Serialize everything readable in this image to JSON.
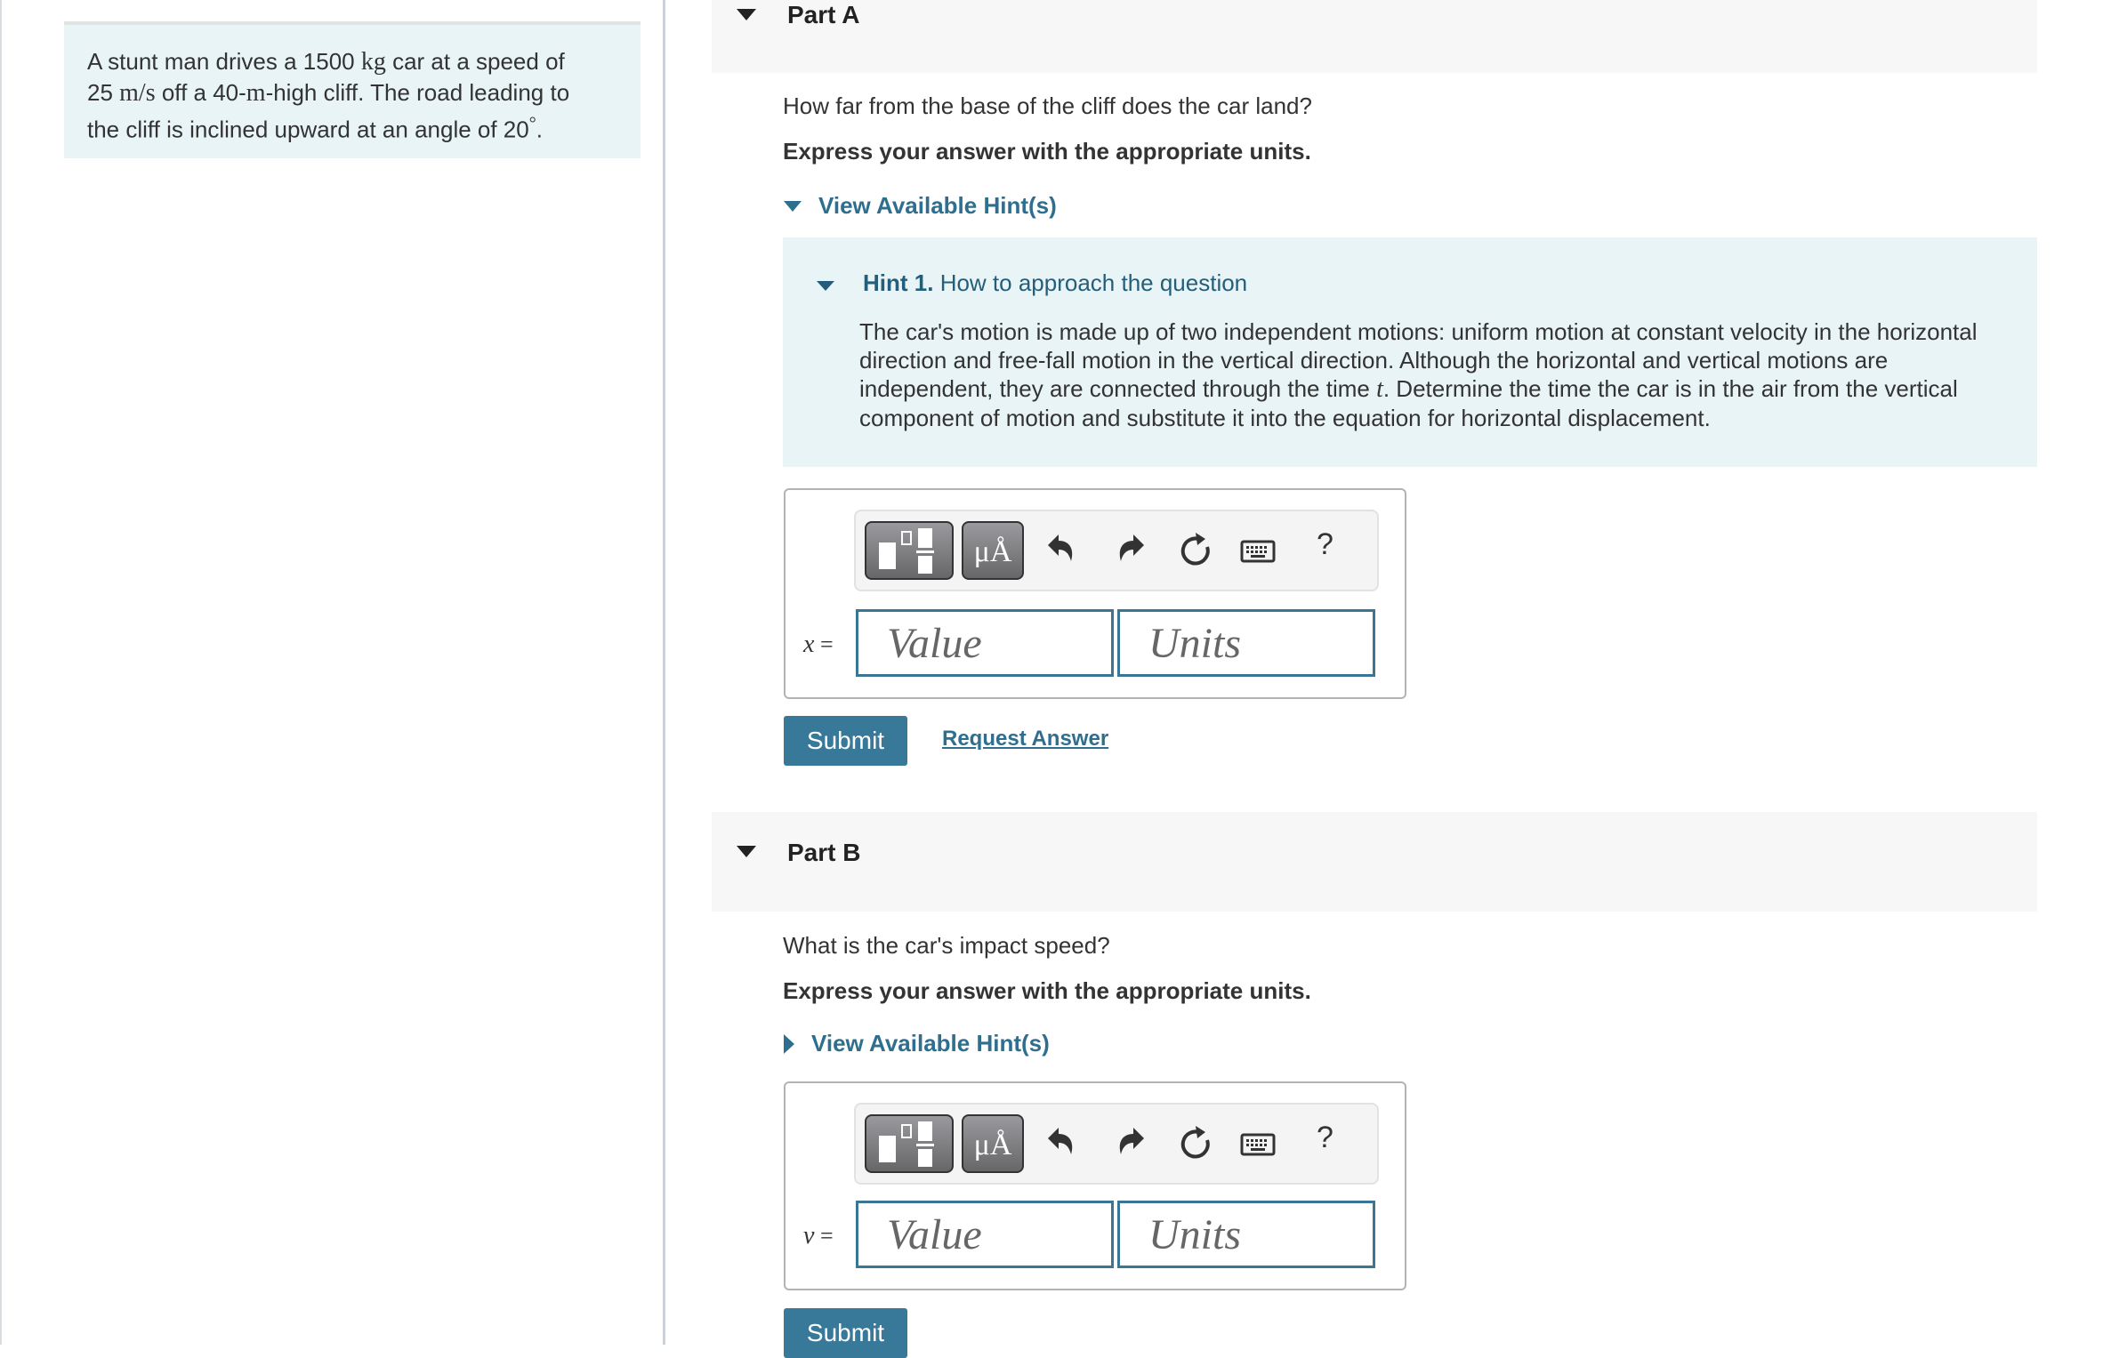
{
  "problem": {
    "text_parts": {
      "p1": "A stunt man drives a 1500 ",
      "u1": "kg",
      "p2": " car at a speed of",
      "p3": "25 ",
      "u2": "m/s",
      "p4": " off a 40-",
      "u3": "m",
      "p5": "-high cliff. The road leading to",
      "p6": "the cliff is inclined upward at an angle of 20",
      "deg": "°",
      "p7": "."
    }
  },
  "parts": [
    {
      "title": "Part A",
      "question": "How far from the base of the cliff does the car land?",
      "instruction": "Express your answer with the appropriate units.",
      "hints_link": "View Available Hint(s)",
      "hints_expanded": true,
      "hint": {
        "label": "Hint 1.",
        "title": "How to approach the question",
        "body_before_var": "The car's motion is made up of two independent motions: uniform motion at constant velocity in the horizontal direction and free-fall motion in the vertical direction. Although the horizontal and vertical motions are independent, they are connected through the time ",
        "var": "t",
        "body_after_var": ". Determine the time the car is in the air from the vertical component of motion and substitute it into the equation for horizontal displacement."
      },
      "variable": "x",
      "equals": "=",
      "value_placeholder": "Value",
      "units_placeholder": "Units",
      "submit_label": "Submit",
      "request_answer_label": "Request Answer"
    },
    {
      "title": "Part B",
      "question": "What is the car's impact speed?",
      "instruction": "Express your answer with the appropriate units.",
      "hints_link": "View Available Hint(s)",
      "hints_expanded": false,
      "variable": "v",
      "equals": "=",
      "value_placeholder": "Value",
      "units_placeholder": "Units",
      "submit_label": "Submit"
    }
  ],
  "toolbar": {
    "templates_icon": "templates-icon",
    "symbols_label": "μÅ",
    "undo_icon": "undo-icon",
    "redo_icon": "redo-icon",
    "reset_icon": "reset-icon",
    "keyboard_icon": "keyboard-icon",
    "help_label": "?"
  },
  "colors": {
    "accent": "#387899",
    "link": "#2e6e8e",
    "hint_bg": "#e9f4f7",
    "part_header_bg": "#f7f7f7"
  }
}
